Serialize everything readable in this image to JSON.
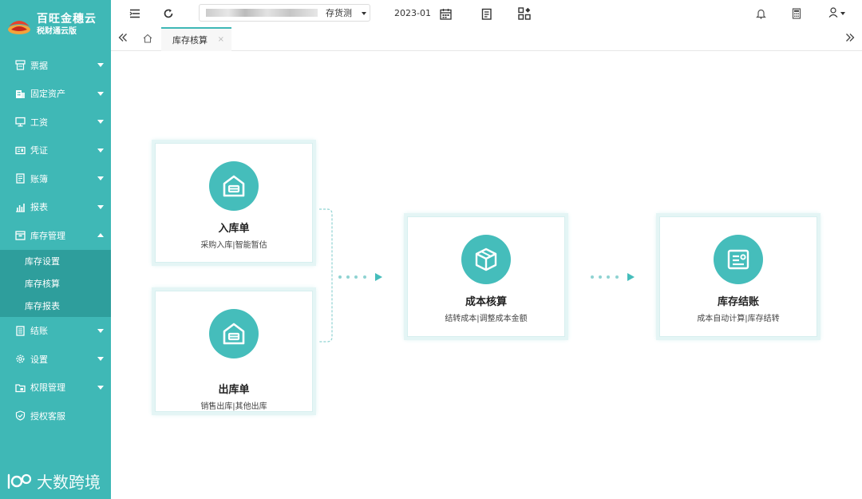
{
  "app": {
    "title": "百旺金穗云",
    "subtitle": "税财通云版"
  },
  "sidebar": {
    "items": [
      {
        "label": "票据",
        "icon": "receipt-icon"
      },
      {
        "label": "固定资产",
        "icon": "building-icon"
      },
      {
        "label": "工资",
        "icon": "monitor-icon"
      },
      {
        "label": "凭证",
        "icon": "voucher-icon"
      },
      {
        "label": "账簿",
        "icon": "ledger-icon"
      },
      {
        "label": "报表",
        "icon": "bar-chart-icon"
      },
      {
        "label": "库存管理",
        "icon": "inventory-icon"
      },
      {
        "label": "结账",
        "icon": "checkout-icon"
      },
      {
        "label": "设置",
        "icon": "gear-icon"
      },
      {
        "label": "权限管理",
        "icon": "folder-lock-icon"
      },
      {
        "label": "授权客服",
        "icon": "shield-check-icon"
      }
    ],
    "submenu": [
      "库存设置",
      "库存核算",
      "库存报表"
    ]
  },
  "watermark": {
    "text": "大数跨境"
  },
  "topbar": {
    "company_value": "存货测",
    "period": "2023-01"
  },
  "tabs": [
    {
      "label": "库存核算",
      "close": "×"
    }
  ],
  "flow": {
    "cards": [
      {
        "title": "入库单",
        "subtitle": "采购入库|智能暂估",
        "icon": "warehouse-icon"
      },
      {
        "title": "出库单",
        "subtitle": "销售出库|其他出库",
        "icon": "warehouse-icon"
      },
      {
        "title": "成本核算",
        "subtitle": "结转成本|调整成本金额",
        "icon": "box-icon"
      },
      {
        "title": "库存结账",
        "subtitle": "成本自动计算|库存结转",
        "icon": "document-icon"
      }
    ]
  },
  "colors": {
    "accent": "#3fb8b6",
    "accent_dark": "#2e9e9c",
    "circle": "#45bdbb"
  }
}
